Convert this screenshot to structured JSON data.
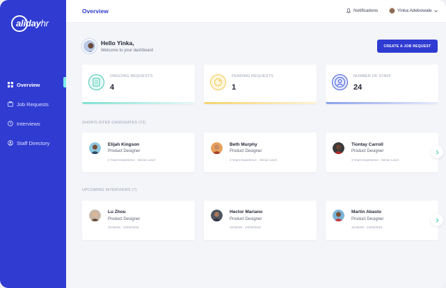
{
  "app": {
    "logo_bold": "aliday",
    "logo_light": "hr"
  },
  "sidebar": {
    "items": [
      {
        "label": "Overview",
        "icon": "grid-icon",
        "active": true
      },
      {
        "label": "Job Requests",
        "icon": "briefcase-icon",
        "active": false
      },
      {
        "label": "Interviews",
        "icon": "clock-icon",
        "active": false
      },
      {
        "label": "Staff Directory",
        "icon": "user-circle-icon",
        "active": false
      }
    ]
  },
  "header": {
    "title": "Overview",
    "notifications_label": "Notifications",
    "user_name": "Yinka Adebowale"
  },
  "greeting": {
    "title": "Hello Yinka,",
    "subtitle": "Welcome to your dashboard",
    "cta_label": "CREATE A JOB REQUEST"
  },
  "stats": [
    {
      "label": "ONGOING REQUESTS",
      "value": "4",
      "color": "#46c7b3"
    },
    {
      "label": "PENDING REQUESTS",
      "value": "1",
      "color": "#f2c94c"
    },
    {
      "label": "NUMBER OF STAFF",
      "value": "24",
      "color": "#3f5bd8"
    }
  ],
  "shortlisted": {
    "title": "SHORTLISTED CANDIDATES (72)",
    "items": [
      {
        "name": "Elijah Kingson",
        "role": "Product Designer",
        "meta": "3 Years Experience · Senior Level"
      },
      {
        "name": "Beth Murphy",
        "role": "Product Designer",
        "meta": "3 Years Experience · Senior Level"
      },
      {
        "name": "Tiontay Carroll",
        "role": "Product Designer",
        "meta": "3 Years Experience · Senior Level"
      }
    ]
  },
  "interviews": {
    "title": "UPCOMING INTERVIEWS (7)",
    "items": [
      {
        "name": "Lu Zhou",
        "role": "Product Designer",
        "meta": "10:00AM · 24/03/2018"
      },
      {
        "name": "Hector Mariano",
        "role": "Product Designer",
        "meta": "10:00AM · 24/03/2018"
      },
      {
        "name": "Martin Abasto",
        "role": "Product Designer",
        "meta": "10:00AM · 24/03/2018"
      }
    ]
  },
  "colors": {
    "primary": "#2f3bd1",
    "accent": "#7df0ea",
    "background": "#f4f5f9"
  }
}
